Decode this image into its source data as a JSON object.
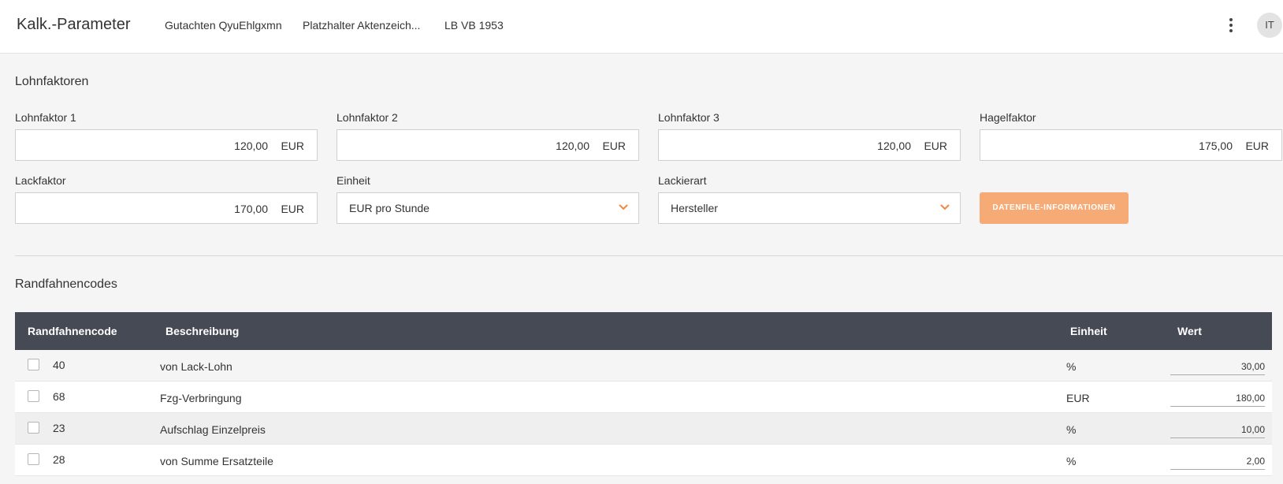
{
  "header": {
    "title": "Kalk.-Parameter",
    "breadcrumbs": [
      "Gutachten QyuEhlgxmn",
      "Platzhalter Aktenzeich...",
      "LB VB 1953"
    ],
    "avatar": "IT"
  },
  "lohnfaktoren": {
    "title": "Lohnfaktoren",
    "fields": [
      {
        "label": "Lohnfaktor 1",
        "value": "120,00",
        "unit": "EUR"
      },
      {
        "label": "Lohnfaktor 2",
        "value": "120,00",
        "unit": "EUR"
      },
      {
        "label": "Lohnfaktor 3",
        "value": "120,00",
        "unit": "EUR"
      },
      {
        "label": "Hagelfaktor",
        "value": "175,00",
        "unit": "EUR"
      },
      {
        "label": "Lackfaktor",
        "value": "170,00",
        "unit": "EUR"
      }
    ],
    "einheit": {
      "label": "Einheit",
      "value": "EUR pro Stunde"
    },
    "lackierart": {
      "label": "Lackierart",
      "value": "Hersteller"
    },
    "info_button": "DATENFILE-INFORMATIONEN"
  },
  "randfahnencodes": {
    "title": "Randfahnencodes",
    "columns": [
      "Randfahnencode",
      "Beschreibung",
      "Einheit",
      "Wert"
    ],
    "rows": [
      {
        "code": "40",
        "desc": "von Lack-Lohn",
        "unit": "%",
        "value": "30,00"
      },
      {
        "code": "68",
        "desc": "Fzg-Verbringung",
        "unit": "EUR",
        "value": "180,00"
      },
      {
        "code": "23",
        "desc": "Aufschlag Einzelpreis",
        "unit": "%",
        "value": "10,00"
      },
      {
        "code": "28",
        "desc": "von Summe Ersatzteile",
        "unit": "%",
        "value": "2,00"
      }
    ]
  },
  "colors": {
    "accent": "#f0883e",
    "button_bg": "#f6ab76",
    "table_header_bg": "#464a55",
    "row_alt": "#f0f0f0"
  },
  "icons": [
    "more-vert-icon",
    "chevron-down-icon",
    "checkbox-icon"
  ]
}
